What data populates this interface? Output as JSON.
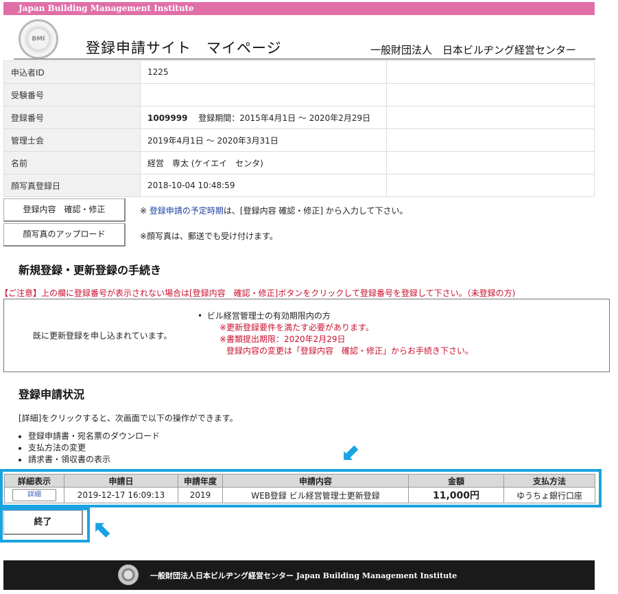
{
  "header": {
    "banner": "Japan Building Management Institute",
    "logo_text": "BMI",
    "site_title": "登録申請サイト　マイページ",
    "org_name": "一般財団法人　日本ビルヂング経営センター"
  },
  "info_rows": [
    {
      "label": "申込者ID",
      "value": "1225"
    },
    {
      "label": "受験番号",
      "value": ""
    },
    {
      "label": "登録番号",
      "value_number": "1009999",
      "value": "登録期間：2015年4月1日 ～ 2020年2月29日"
    },
    {
      "label": "管理士会",
      "value": "2019年4月1日 ～ 2020年3月31日"
    },
    {
      "label": "名前",
      "value": "経営　専太 (ケイエイ　センタ)"
    },
    {
      "label": "顔写真登録日",
      "value": "2018-10-04 10:48:59"
    }
  ],
  "actions": {
    "confirm_edit_label": "登録内容　確認・修正",
    "confirm_note_prefix": "※ ",
    "confirm_note_link": "登録申請の予定時期",
    "confirm_note_suffix": "は、[登録内容 確認・修正] から入力して下さい。",
    "upload_label": "顔写真のアップロード",
    "upload_note": "※顔写真は、郵送でも受け付けます。"
  },
  "procedure": {
    "title": "新規登録・更新登録の手続き",
    "caution": "【ご注意】上の欄に登録番号が表示されない場合は[登録内容　確認・修正]ボタンをクリックして登録番号を登録して下さい。（未登録の方)",
    "status": "既に更新登録を申し込まれています。",
    "bullet": "ビル経営管理士の有効期限内の方",
    "req_note": "※更新登録要件を満たす必要があります。",
    "deadline": "※書類提出期限：2020年2月29日",
    "change_note": "登録内容の変更は「登録内容　確認・修正」からお手続き下さい。"
  },
  "application": {
    "title": "登録申請状況",
    "description": "[詳細]をクリックすると、次画面で以下の操作ができます。",
    "operations": [
      "登録申請書・宛名票のダウンロード",
      "支払方法の変更",
      "請求書・領収書の表示"
    ],
    "headers": [
      "詳細表示",
      "申請日",
      "申請年度",
      "申請内容",
      "金額",
      "支払方法"
    ],
    "row": {
      "detail_label": "詳細",
      "date": "2019-12-17 16:09:13",
      "year": "2019",
      "content": "WEB登録 ビル経営管理士更新登録",
      "amount": "11,000円",
      "payment": "ゆうちょ銀行口座"
    }
  },
  "end_button": "終了",
  "footer": {
    "text": "一般財団法人日本ビルヂング経営センター Japan Building Management Institute"
  },
  "colors": {
    "banner": "#e06fa8",
    "highlight": "#1aa3e0",
    "warning": "#c8102e",
    "link": "#1d3fa0",
    "footer_bg": "#1a1a1a"
  },
  "icons": {
    "highlight_arrows": "arrow-icon",
    "logo": "logo-seal-icon"
  }
}
